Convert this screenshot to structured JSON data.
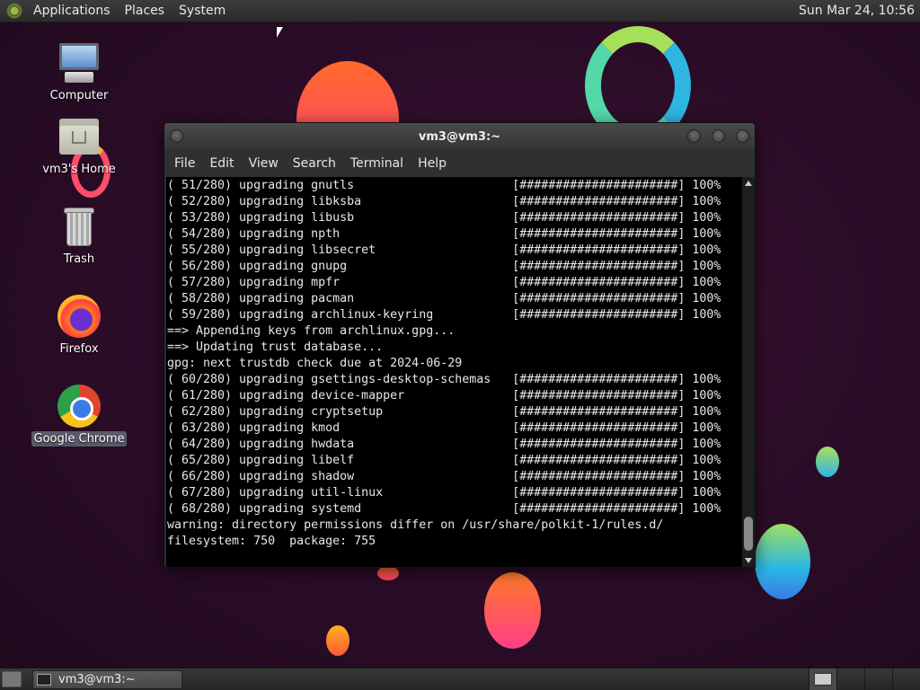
{
  "top_panel": {
    "menu": [
      "Applications",
      "Places",
      "System"
    ],
    "clock": "Sun Mar 24, 10:56"
  },
  "desktop_icons": [
    {
      "label": "Computer",
      "icon": "computer-icon"
    },
    {
      "label": "vm3's Home",
      "icon": "home-folder-icon"
    },
    {
      "label": "Trash",
      "icon": "trash-icon"
    },
    {
      "label": "Firefox",
      "icon": "firefox-icon"
    },
    {
      "label": "Google Chrome",
      "icon": "chrome-icon",
      "selected": true
    }
  ],
  "terminal": {
    "title": "vm3@vm3:~",
    "menu": [
      "File",
      "Edit",
      "View",
      "Search",
      "Terminal",
      "Help"
    ],
    "lines": [
      "( 51/280) upgrading gnutls                      [######################] 100%",
      "( 52/280) upgrading libksba                     [######################] 100%",
      "( 53/280) upgrading libusb                      [######################] 100%",
      "( 54/280) upgrading npth                        [######################] 100%",
      "( 55/280) upgrading libsecret                   [######################] 100%",
      "( 56/280) upgrading gnupg                       [######################] 100%",
      "( 57/280) upgrading mpfr                        [######################] 100%",
      "( 58/280) upgrading pacman                      [######################] 100%",
      "( 59/280) upgrading archlinux-keyring           [######################] 100%",
      "==> Appending keys from archlinux.gpg...",
      "==> Updating trust database...",
      "gpg: next trustdb check due at 2024-06-29",
      "( 60/280) upgrading gsettings-desktop-schemas   [######################] 100%",
      "( 61/280) upgrading device-mapper               [######################] 100%",
      "( 62/280) upgrading cryptsetup                  [######################] 100%",
      "( 63/280) upgrading kmod                        [######################] 100%",
      "( 64/280) upgrading hwdata                      [######################] 100%",
      "( 65/280) upgrading libelf                      [######################] 100%",
      "( 66/280) upgrading shadow                      [######################] 100%",
      "( 67/280) upgrading util-linux                  [######################] 100%",
      "( 68/280) upgrading systemd                     [######################] 100%",
      "warning: directory permissions differ on /usr/share/polkit-1/rules.d/",
      "filesystem: 750  package: 755"
    ]
  },
  "bottom_panel": {
    "task_label": "vm3@vm3:~"
  }
}
